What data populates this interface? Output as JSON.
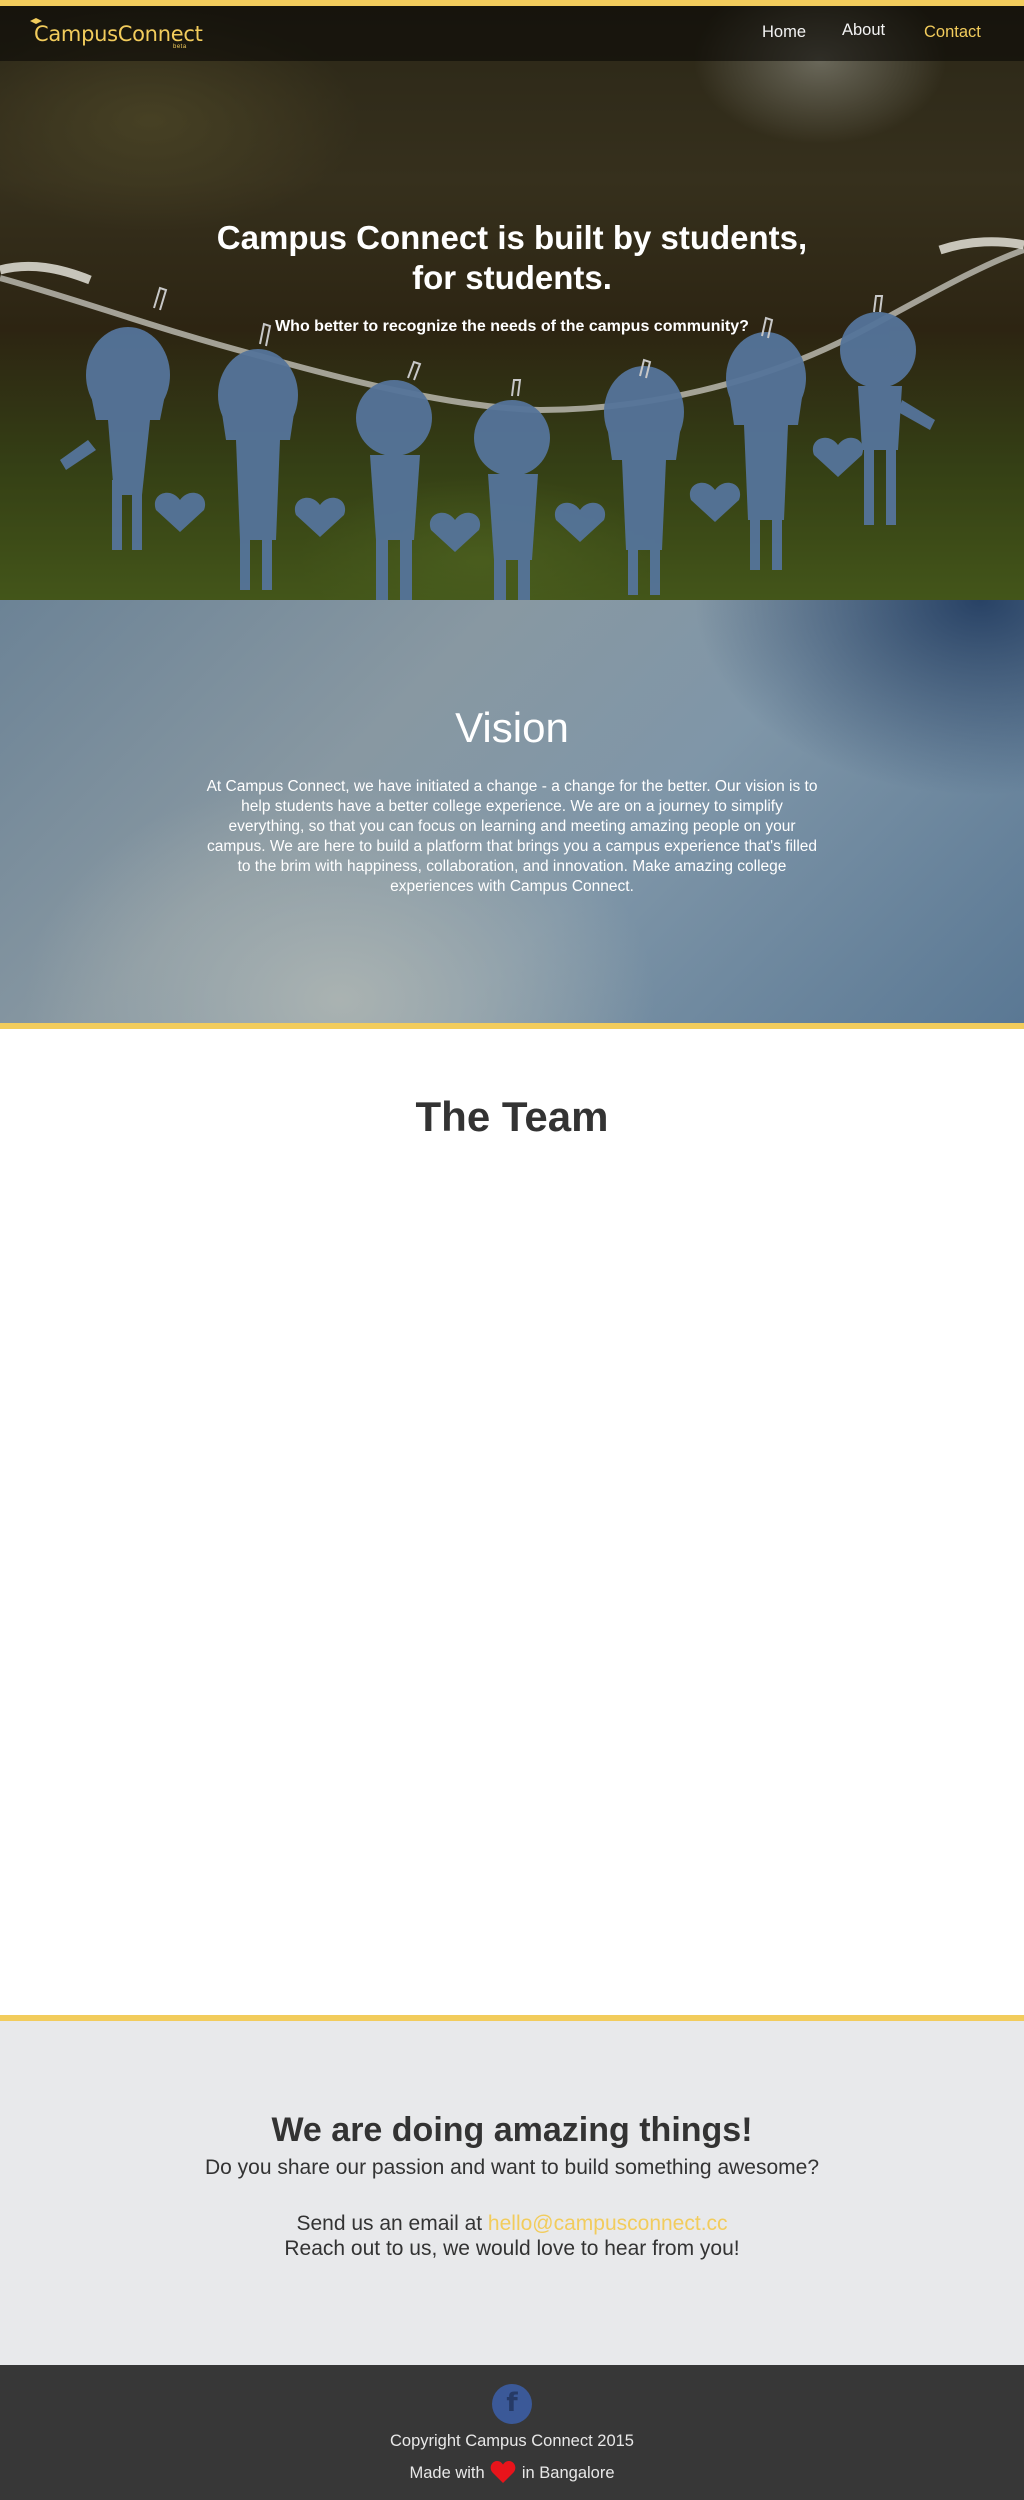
{
  "nav": {
    "logo_text": "CampusConnect",
    "logo_tag": "beta",
    "links": [
      {
        "label": "Home"
      },
      {
        "label": "About"
      },
      {
        "label": "Contact"
      }
    ],
    "accent_color": "#f2cc5c"
  },
  "hero": {
    "title_line1": "Campus Connect is built by students,",
    "title_line2": "for students.",
    "subtitle": "Who better to recognize the needs of the campus community?"
  },
  "vision": {
    "title": "Vision",
    "body": "At Campus Connect, we have initiated a change - a change for the better. Our vision is to help students have a better college experience. We are on a journey to simplify everything, so that you can focus on learning and meeting amazing people on your campus. We are here to build a platform that brings you a campus experience that's filled to the brim with happiness, collaboration, and innovation. Make amazing college experiences with Campus Connect."
  },
  "team": {
    "title": "The Team"
  },
  "join": {
    "title": "We are doing amazing things!",
    "subtitle": "Do you share our passion and want to build something awesome?",
    "email_prefix": "Send us an email at ",
    "email": "hello@campusconnect.cc",
    "reach": "Reach out to us, we would love to hear from you!"
  },
  "footer": {
    "facebook_icon": "facebook-icon",
    "facebook_glyph": "f",
    "copyright": "Copyright Campus Connect 2015",
    "made_prefix": "Made with",
    "made_suffix": "in Bangalore",
    "heart_icon": "heart-icon",
    "heart_color": "#e8141b"
  }
}
